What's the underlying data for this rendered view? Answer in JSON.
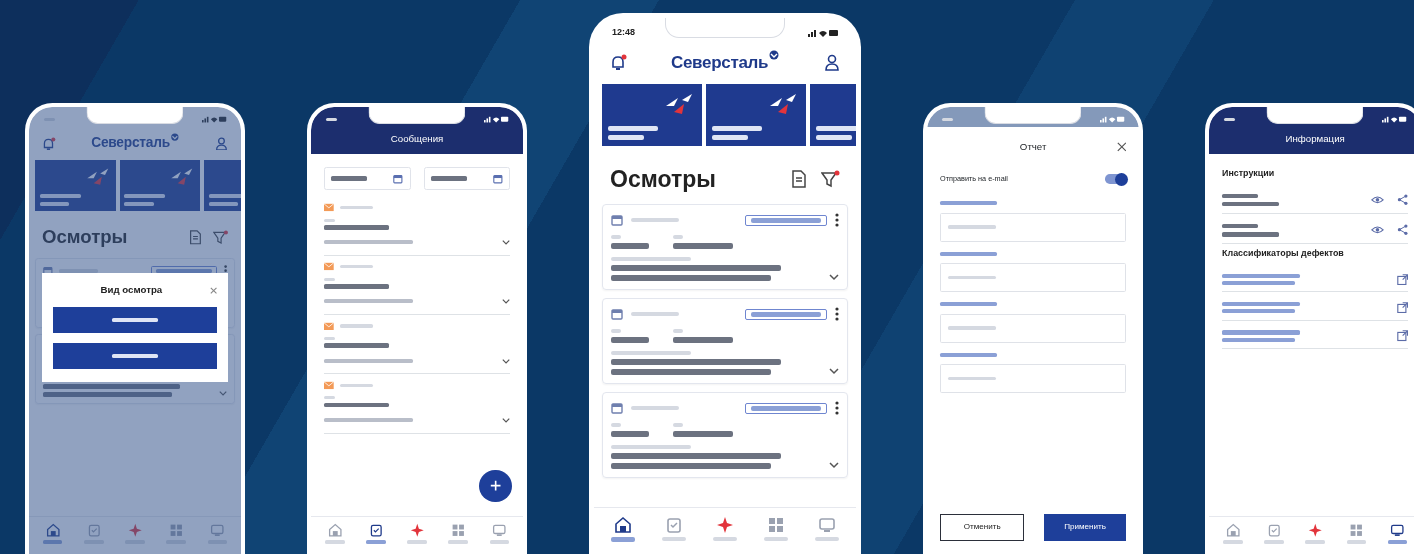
{
  "phones": [
    {
      "kind": "home",
      "brand": "Северсталь",
      "heading": "Осмотры",
      "cards": [
        {
          "kind": "inspection"
        },
        {
          "kind": "inspection"
        }
      ],
      "modal": {
        "title": "Вид осмотра",
        "buttons": [
          {
            "kind": "primary"
          },
          {
            "kind": "primary"
          }
        ]
      },
      "nav": [
        {
          "selected": true
        },
        {
          "selected": false
        },
        {
          "selected": false
        },
        {
          "selected": false
        },
        {
          "selected": false
        }
      ]
    },
    {
      "kind": "messages",
      "title": "Сообщения",
      "entries": [
        {
          "kind": "message"
        },
        {
          "kind": "message"
        },
        {
          "kind": "message"
        },
        {
          "kind": "message"
        }
      ],
      "nav": [
        {
          "selected": false
        },
        {
          "selected": true
        },
        {
          "selected": false
        },
        {
          "selected": false
        },
        {
          "selected": false
        }
      ]
    },
    {
      "kind": "home",
      "status_time": "12:48",
      "brand": "Северсталь",
      "heading": "Осмотры",
      "cards": [
        {
          "kind": "inspection"
        },
        {
          "kind": "inspection"
        },
        {
          "kind": "inspection"
        }
      ],
      "nav": [
        {
          "selected": true
        },
        {
          "selected": false
        },
        {
          "selected": false
        },
        {
          "selected": false
        },
        {
          "selected": false
        }
      ]
    },
    {
      "kind": "report",
      "title": "Отчет",
      "toggle": {
        "label": "Отправить на e-mail",
        "on": true
      },
      "fields": [
        {
          "kind": "input"
        },
        {
          "kind": "input"
        },
        {
          "kind": "input"
        },
        {
          "kind": "input"
        }
      ],
      "buttons": [
        {
          "label": "Отменить",
          "kind": "outline"
        },
        {
          "label": "Применить",
          "kind": "primary"
        }
      ]
    },
    {
      "kind": "info",
      "title": "Информация",
      "sections": [
        {
          "title": "Инструкции",
          "items": [
            {
              "kind": "viewable"
            },
            {
              "kind": "viewable"
            }
          ]
        },
        {
          "title": "Классификаторы дефектов",
          "items": [
            {
              "kind": "link"
            },
            {
              "kind": "link"
            },
            {
              "kind": "link"
            }
          ]
        }
      ],
      "nav": [
        {
          "selected": false
        },
        {
          "selected": false
        },
        {
          "selected": false
        },
        {
          "selected": false
        },
        {
          "selected": true
        }
      ]
    }
  ]
}
